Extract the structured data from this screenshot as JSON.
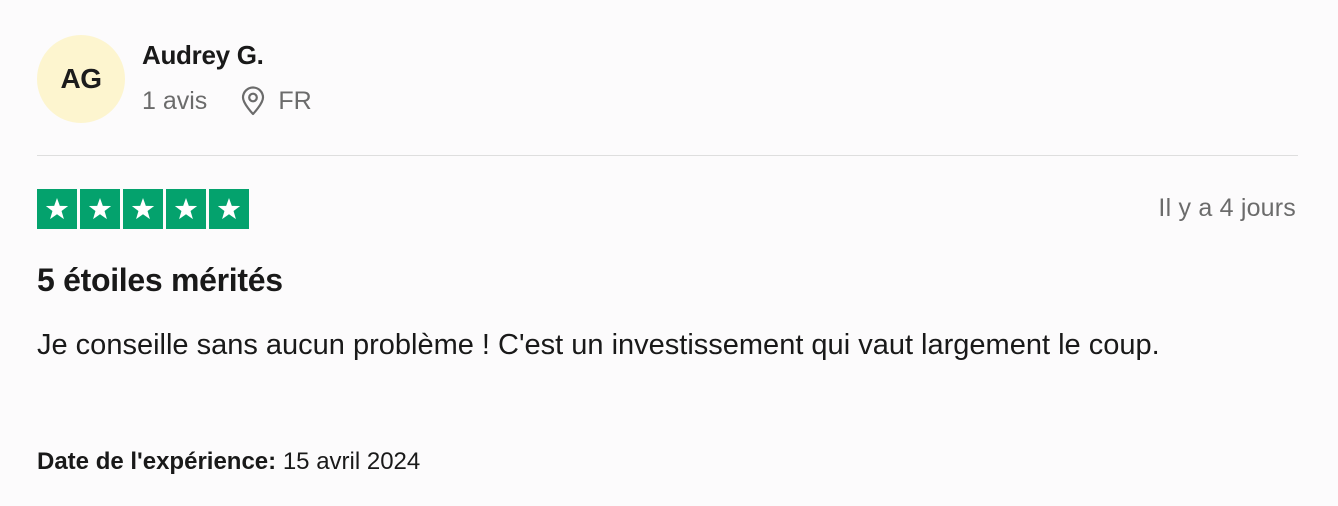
{
  "reviewer": {
    "initials": "AG",
    "name": "Audrey G.",
    "review_count": "1 avis",
    "location_icon": "map-pin-icon",
    "country": "FR"
  },
  "rating": {
    "stars": 5,
    "max_stars": 5,
    "star_color": "#04a26d",
    "posted_ago": "Il y a 4 jours"
  },
  "review": {
    "title": "5 étoiles mérités",
    "text": "Je conseille sans aucun problème ! C'est un investissement qui vaut largement le coup.",
    "experience_label": "Date de l'expérience:",
    "experience_date": "15 avril 2024"
  },
  "colors": {
    "avatar_bg": "#fdf5cf",
    "muted_text": "#6b6b6b",
    "divider": "#dedede"
  }
}
